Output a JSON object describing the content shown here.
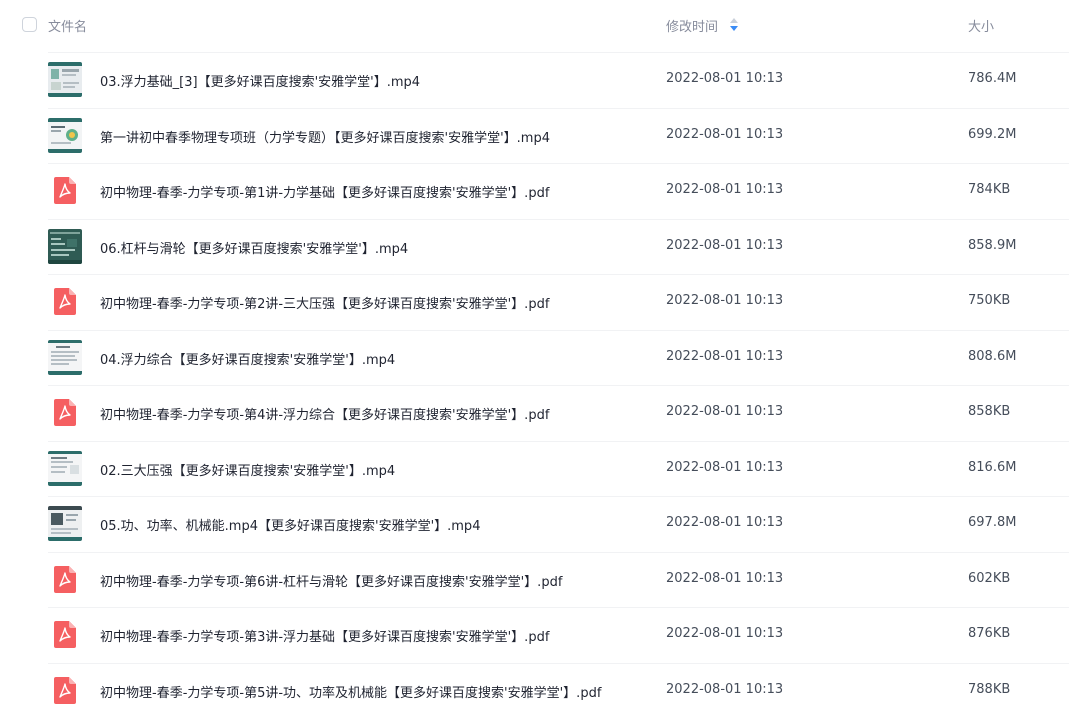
{
  "header": {
    "name_label": "文件名",
    "time_label": "修改时间",
    "size_label": "大小"
  },
  "files": [
    {
      "name": "03.浮力基础_[3]【更多好课百度搜索'安雅学堂'】.mp4",
      "time": "2022-08-01 10:13",
      "size": "786.4M",
      "type": "video",
      "thumb": "t1"
    },
    {
      "name": "第一讲初中春季物理专项班（力学专题）【更多好课百度搜索'安雅学堂'】.mp4",
      "time": "2022-08-01 10:13",
      "size": "699.2M",
      "type": "video",
      "thumb": "t2"
    },
    {
      "name": "初中物理-春季-力学专项-第1讲-力学基础【更多好课百度搜索'安雅学堂'】.pdf",
      "time": "2022-08-01 10:13",
      "size": "784KB",
      "type": "pdf"
    },
    {
      "name": "06.杠杆与滑轮【更多好课百度搜索'安雅学堂'】.mp4",
      "time": "2022-08-01 10:13",
      "size": "858.9M",
      "type": "video",
      "thumb": "t3"
    },
    {
      "name": "初中物理-春季-力学专项-第2讲-三大压强【更多好课百度搜索'安雅学堂'】.pdf",
      "time": "2022-08-01 10:13",
      "size": "750KB",
      "type": "pdf"
    },
    {
      "name": "04.浮力综合【更多好课百度搜索'安雅学堂'】.mp4",
      "time": "2022-08-01 10:13",
      "size": "808.6M",
      "type": "video",
      "thumb": "t4"
    },
    {
      "name": "初中物理-春季-力学专项-第4讲-浮力综合【更多好课百度搜索'安雅学堂'】.pdf",
      "time": "2022-08-01 10:13",
      "size": "858KB",
      "type": "pdf"
    },
    {
      "name": "02.三大压强【更多好课百度搜索'安雅学堂'】.mp4",
      "time": "2022-08-01 10:13",
      "size": "816.6M",
      "type": "video",
      "thumb": "t5"
    },
    {
      "name": "05.功、功率、机械能.mp4【更多好课百度搜索'安雅学堂'】.mp4",
      "time": "2022-08-01 10:13",
      "size": "697.8M",
      "type": "video",
      "thumb": "t6"
    },
    {
      "name": "初中物理-春季-力学专项-第6讲-杠杆与滑轮【更多好课百度搜索'安雅学堂'】.pdf",
      "time": "2022-08-01 10:13",
      "size": "602KB",
      "type": "pdf"
    },
    {
      "name": "初中物理-春季-力学专项-第3讲-浮力基础【更多好课百度搜索'安雅学堂'】.pdf",
      "time": "2022-08-01 10:13",
      "size": "876KB",
      "type": "pdf"
    },
    {
      "name": "初中物理-春季-力学专项-第5讲-功、功率及机械能【更多好课百度搜索'安雅学堂'】.pdf",
      "time": "2022-08-01 10:13",
      "size": "788KB",
      "type": "pdf"
    }
  ],
  "colors": {
    "pdf_red": "#f55f61",
    "header_text": "#878c9c",
    "body_text": "#1f2330",
    "sort_blue": "#3b8cf5"
  },
  "icons": {
    "pdf": "pdf-file-icon",
    "video": "video-thumbnail",
    "sort": "sort-icon",
    "checkbox": "select-all-checkbox"
  }
}
